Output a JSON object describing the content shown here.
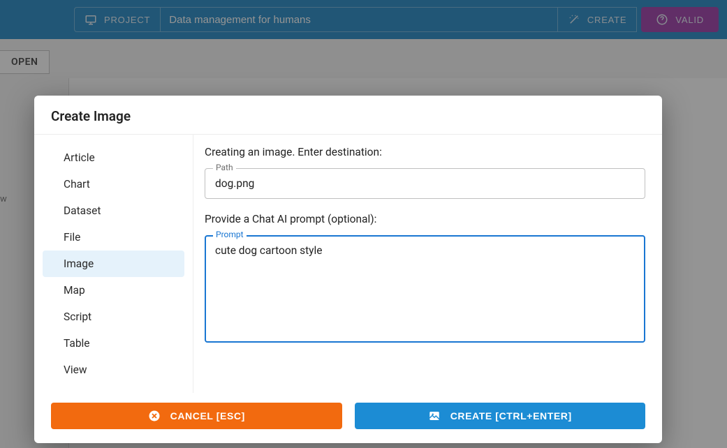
{
  "topbar": {
    "project_label": "PROJECT",
    "title_input": "Data management for humans",
    "create_label": "CREATE",
    "valid_label": "VALID"
  },
  "background": {
    "open_label": "OPEN",
    "side_text": "w"
  },
  "modal": {
    "title": "Create Image",
    "sidebar_items": [
      "Article",
      "Chart",
      "Dataset",
      "File",
      "Image",
      "Map",
      "Script",
      "Table",
      "View"
    ],
    "active_index": 4,
    "form": {
      "dest_text": "Creating an image. Enter destination:",
      "path_label": "Path",
      "path_value": "dog.png",
      "prompt_heading": "Provide a Chat AI prompt (optional):",
      "prompt_label": "Prompt",
      "prompt_value": "cute dog cartoon style"
    },
    "footer": {
      "cancel_label": "CANCEL [ESC]",
      "create_label": "CREATE [CTRL+ENTER]"
    }
  }
}
